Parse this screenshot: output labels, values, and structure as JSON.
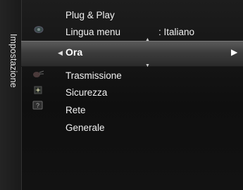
{
  "side_title": "Impostazione",
  "menu": {
    "items": [
      {
        "label": "Plug & Play"
      },
      {
        "label": "Lingua menu",
        "value": ": Italiano"
      },
      {
        "label": "Ora",
        "selected": true
      },
      {
        "label": "Trasmissione"
      },
      {
        "label": "Sicurezza"
      },
      {
        "label": "Rete"
      },
      {
        "label": "Generale"
      }
    ]
  },
  "icons": [
    "picture-icon",
    "settings-gear-icon",
    "channel-icon",
    "security-icon",
    "support-icon"
  ],
  "colors": {
    "background": "#111111",
    "highlight": "#4a4a4a",
    "text": "#f2f2f2"
  }
}
